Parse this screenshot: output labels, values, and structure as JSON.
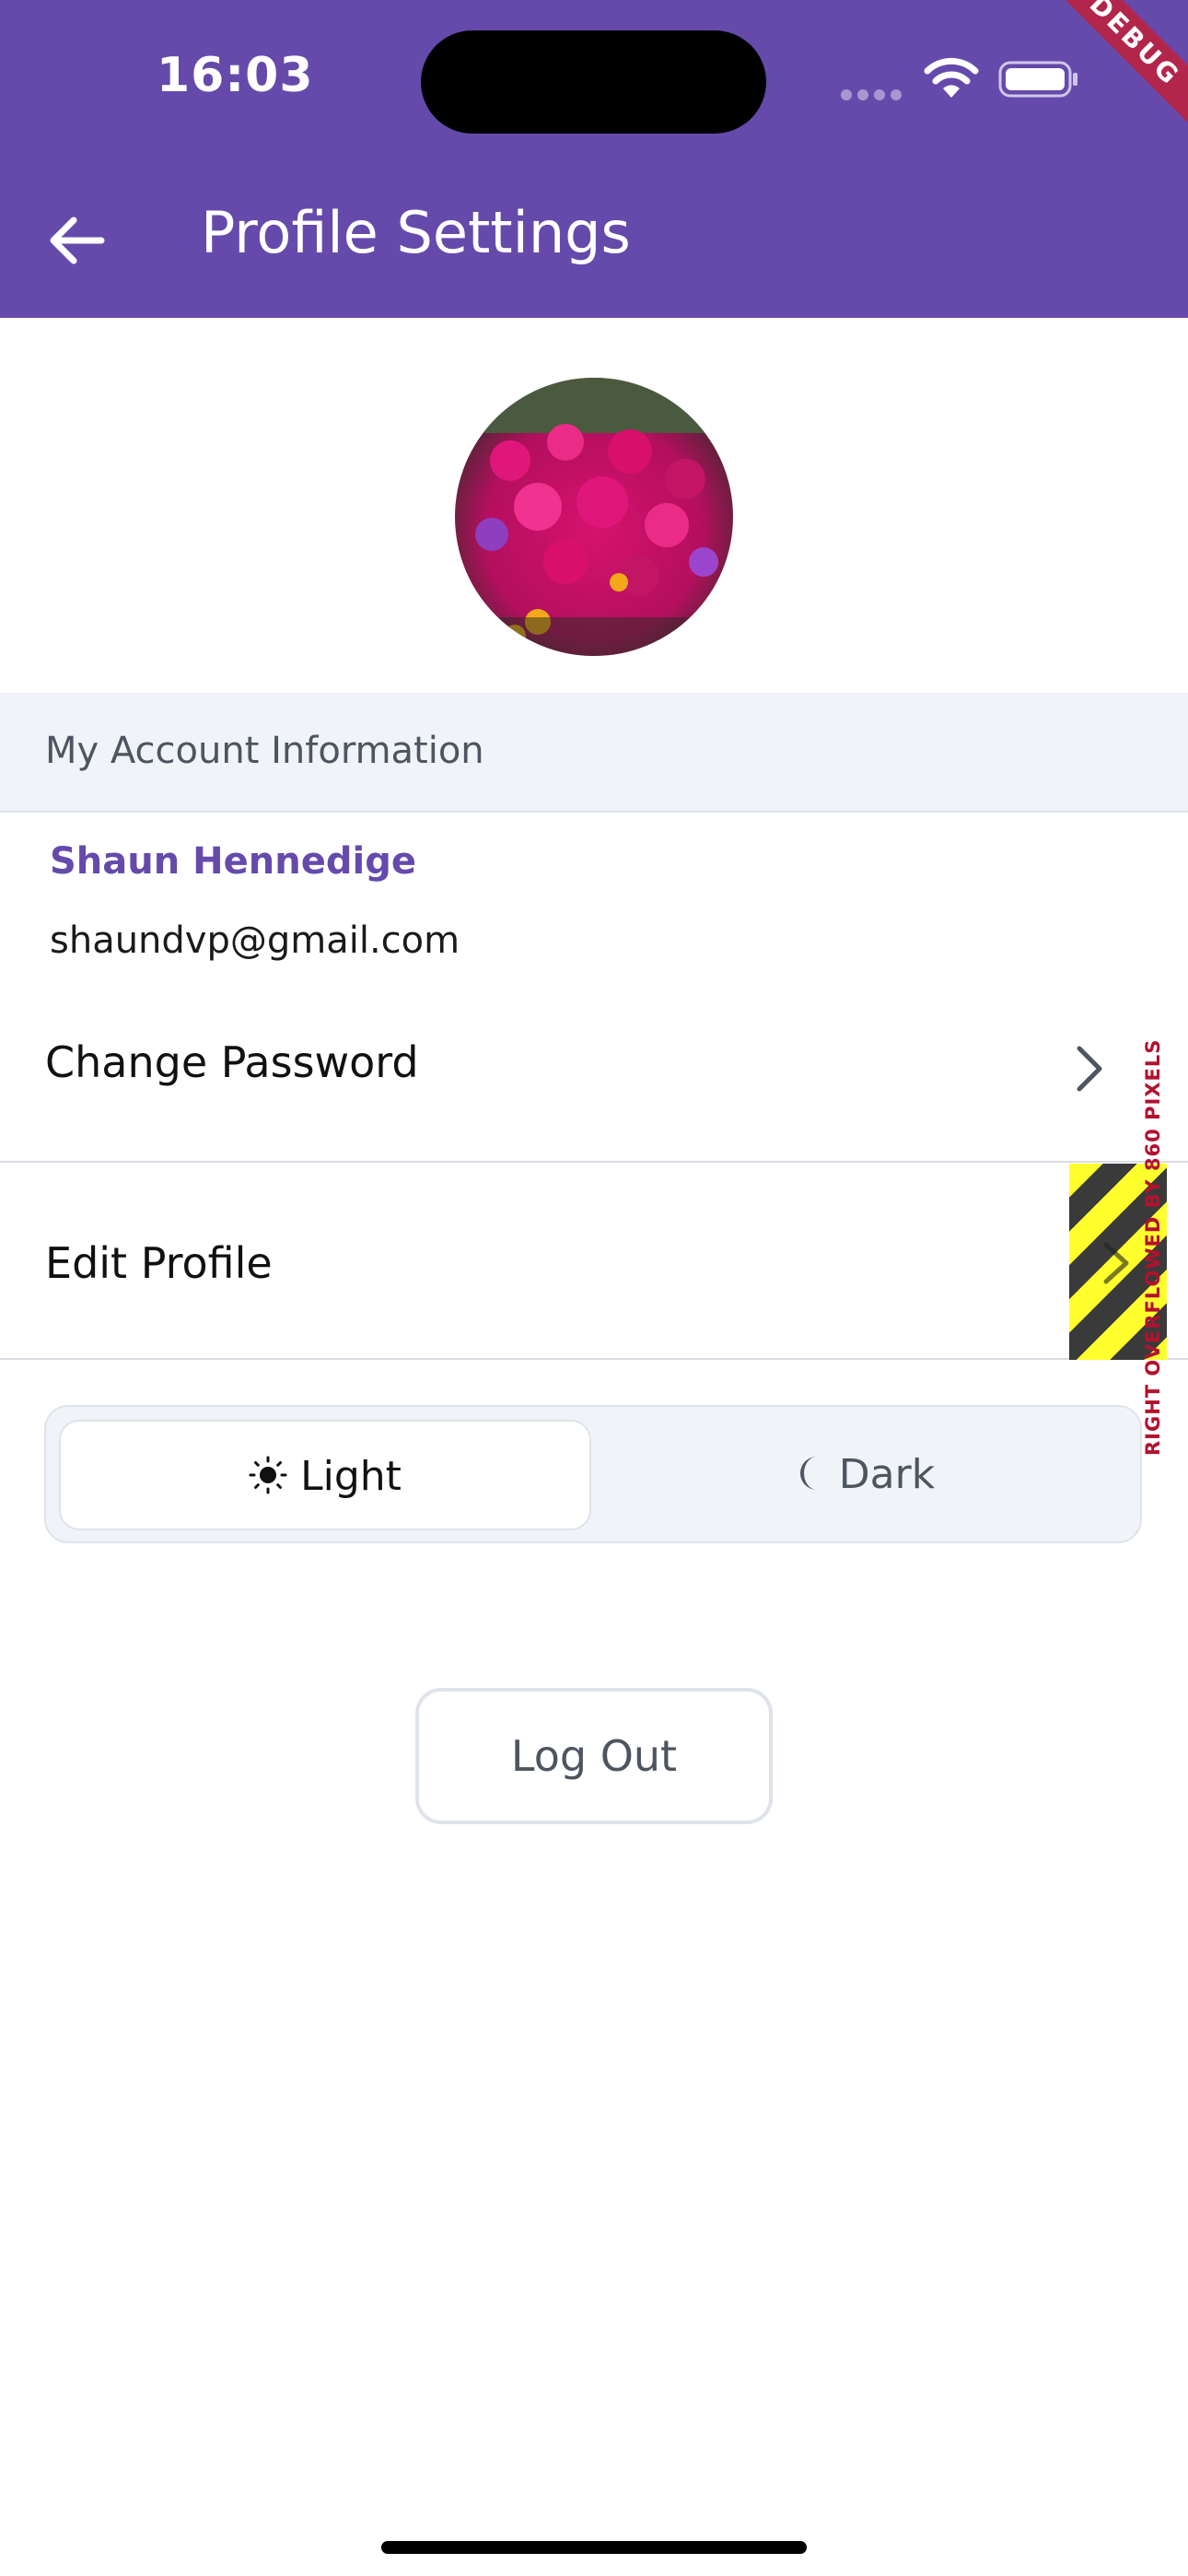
{
  "status_bar": {
    "time": "16:03",
    "debug_label": "DEBUG"
  },
  "app_bar": {
    "title": "Profile Settings",
    "back_icon": "arrow-left-icon",
    "color": "#654aab"
  },
  "profile": {
    "avatar_alt": "profile photo"
  },
  "account_section": {
    "header": "My Account Information",
    "name": "Shaun Hennedige",
    "email": "shaundvp@gmail.com"
  },
  "menu": {
    "items": [
      {
        "label": "Change Password",
        "icon": "chevron-right-icon"
      },
      {
        "label": "Edit Profile",
        "icon": "chevron-right-icon"
      }
    ]
  },
  "overflow_warning": "RIGHT OVERFLOWED BY 860 PIXELS",
  "theme_toggle": {
    "selected": "Light",
    "options": [
      {
        "label": "Light",
        "icon": "sun-icon"
      },
      {
        "label": "Dark",
        "icon": "moon-icon"
      }
    ]
  },
  "logout_label": "Log Out"
}
